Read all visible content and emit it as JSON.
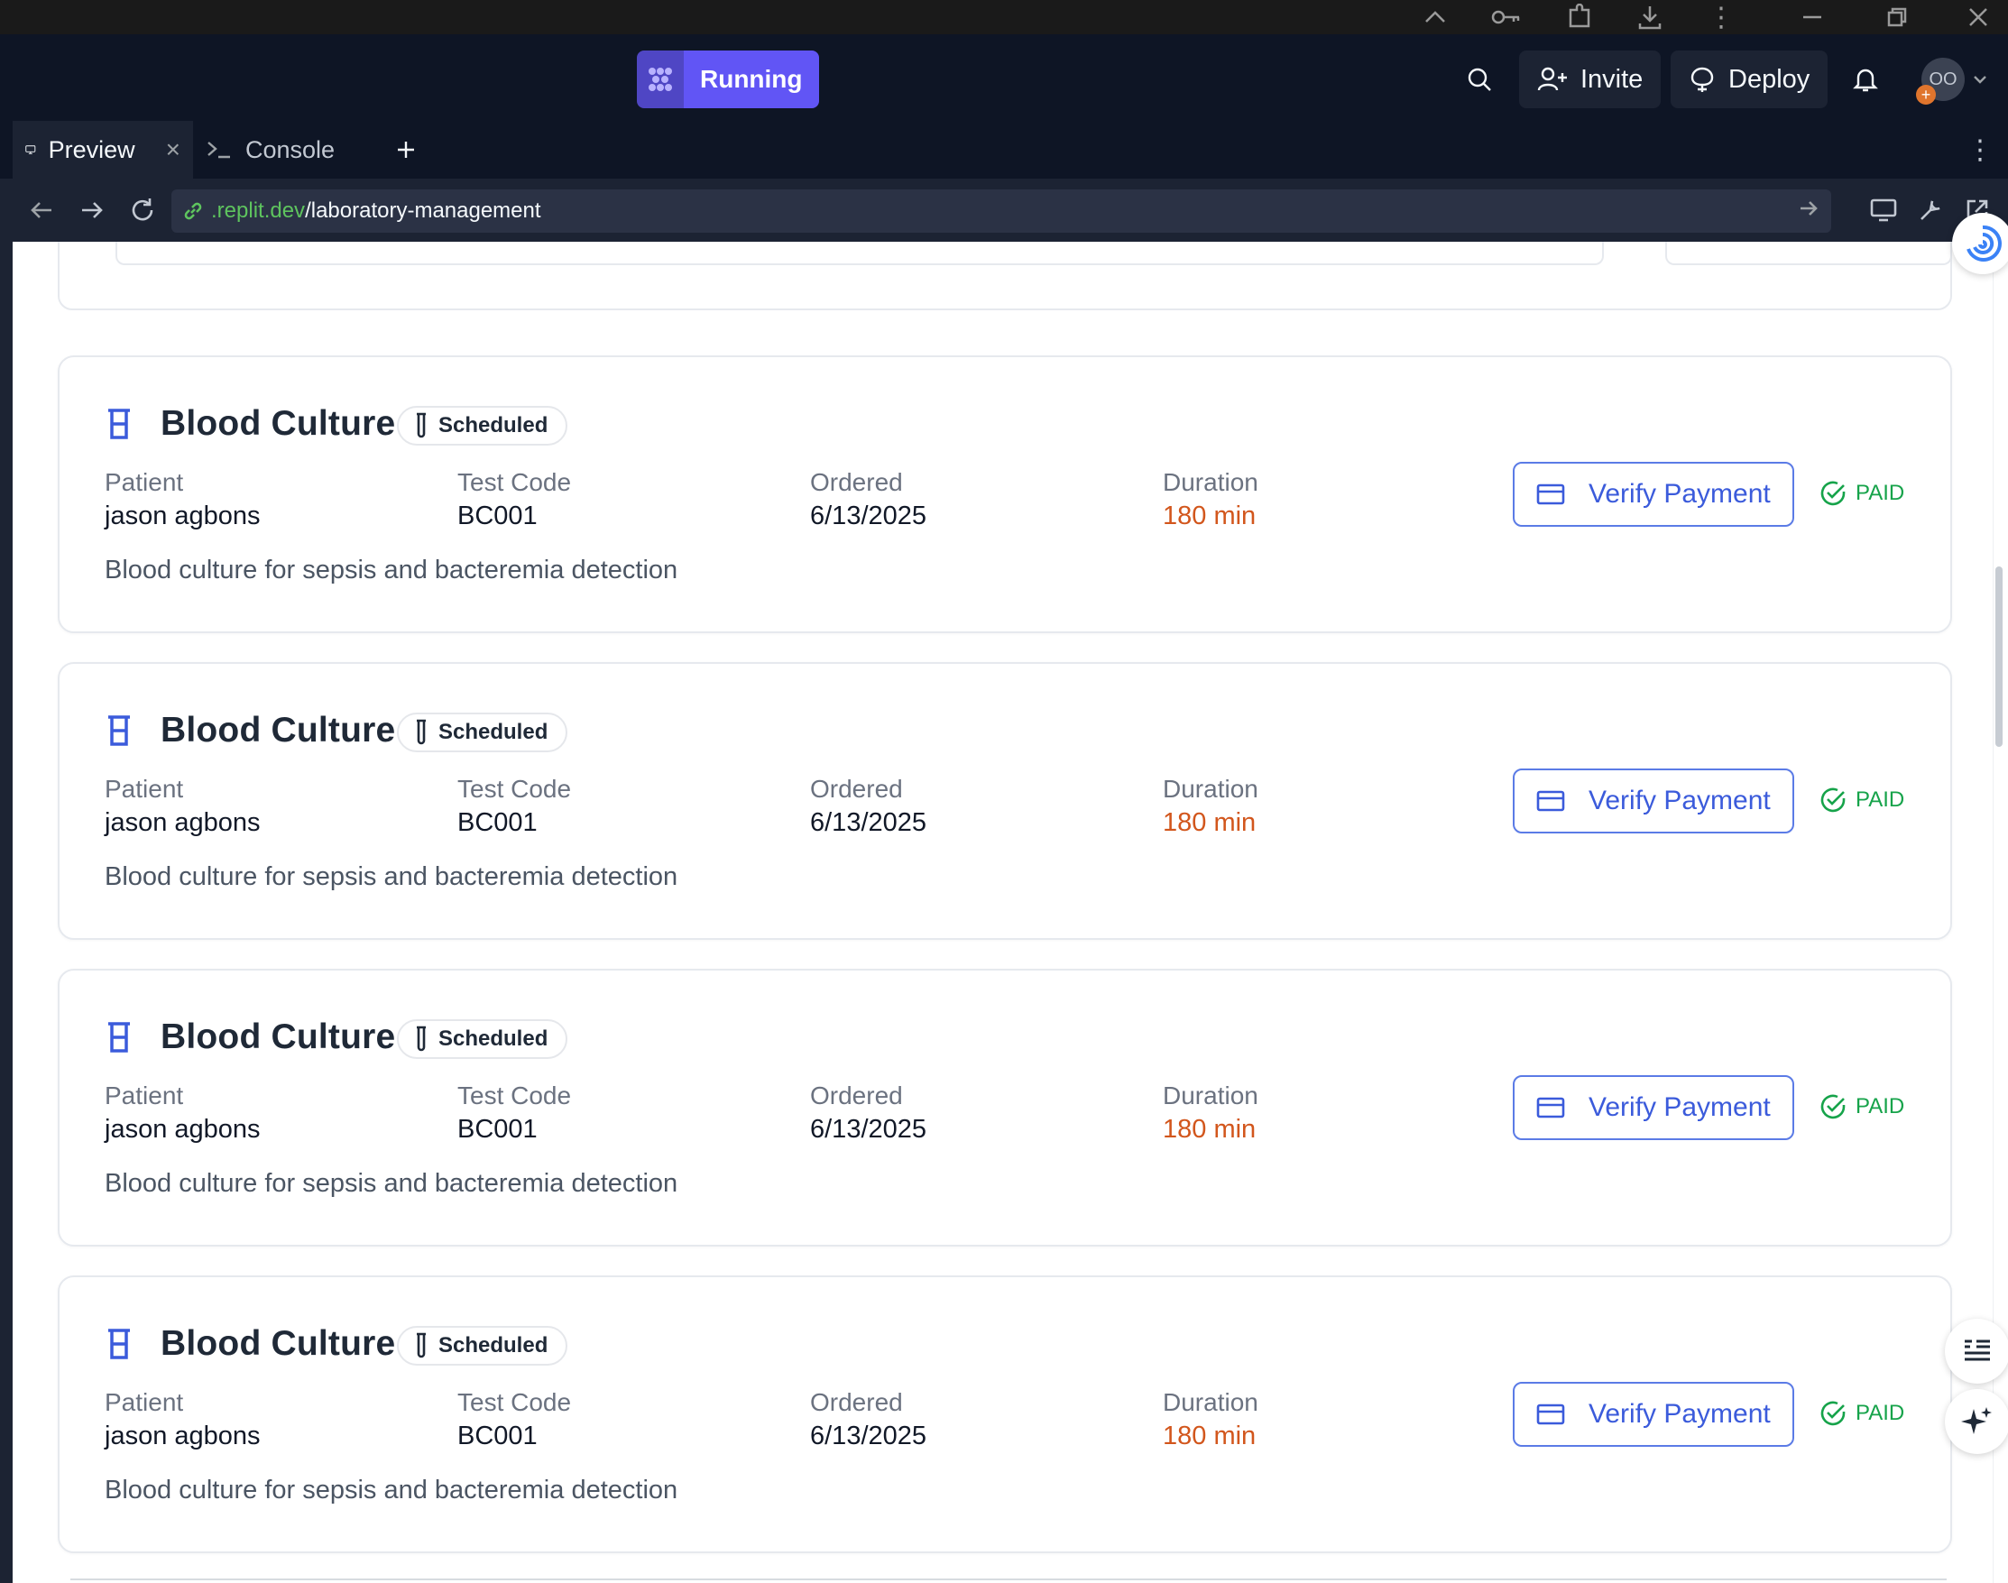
{
  "topbar": {
    "run_status": "Running",
    "invite_label": "Invite",
    "deploy_label": "Deploy",
    "avatar_initials": "OO"
  },
  "tabs": [
    {
      "label": "Preview",
      "icon": "monitor-icon",
      "active": true
    },
    {
      "label": "Console",
      "icon": "terminal-icon",
      "active": false
    }
  ],
  "address": {
    "host": ".replit.dev",
    "path": "/laboratory-management"
  },
  "colors": {
    "accent": "#6155f5",
    "link_blue": "#3b5bdb",
    "duration_orange": "#d2561c",
    "paid_green": "#16a34a"
  },
  "labels": {
    "patient": "Patient",
    "test_code": "Test Code",
    "ordered": "Ordered",
    "duration": "Duration",
    "verify_button": "Verify Payment",
    "paid": "PAID"
  },
  "tests": [
    {
      "name": "Blood Culture",
      "status": "Scheduled",
      "patient": "jason agbons",
      "code": "BC001",
      "ordered": "6/13/2025",
      "duration": "180 min",
      "description": "Blood culture for sepsis and bacteremia detection",
      "payment": "PAID"
    },
    {
      "name": "Blood Culture",
      "status": "Scheduled",
      "patient": "jason agbons",
      "code": "BC001",
      "ordered": "6/13/2025",
      "duration": "180 min",
      "description": "Blood culture for sepsis and bacteremia detection",
      "payment": "PAID"
    },
    {
      "name": "Blood Culture",
      "status": "Scheduled",
      "patient": "jason agbons",
      "code": "BC001",
      "ordered": "6/13/2025",
      "duration": "180 min",
      "description": "Blood culture for sepsis and bacteremia detection",
      "payment": "PAID"
    },
    {
      "name": "Blood Culture",
      "status": "Scheduled",
      "patient": "jason agbons",
      "code": "BC001",
      "ordered": "6/13/2025",
      "duration": "180 min",
      "description": "Blood culture for sepsis and bacteremia detection",
      "payment": "PAID"
    }
  ]
}
